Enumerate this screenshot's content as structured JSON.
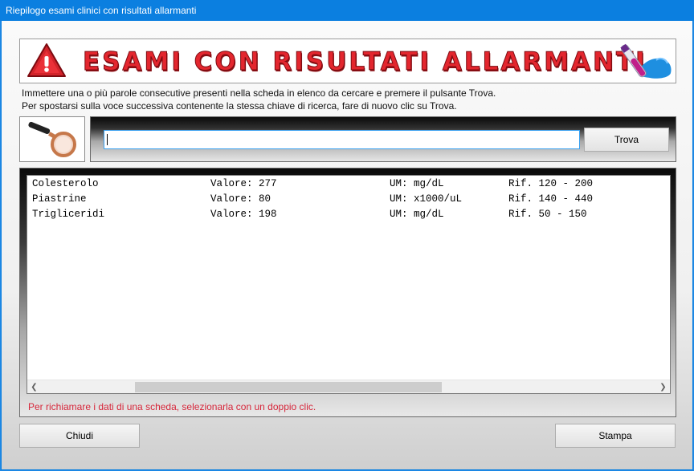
{
  "window": {
    "title": "Riepilogo esami clinici con risultati allarmanti"
  },
  "banner": {
    "title": "ESAMI CON RISULTATI ALLARMANTI",
    "left_icon": "warning-icon",
    "right_icon": "test-tube-icon"
  },
  "instructions": {
    "line1": "Immettere una o più parole consecutive presenti nella scheda in elenco da cercare e premere il pulsante Trova.",
    "line2": "Per spostarsi sulla voce successiva contenente la stessa chiave di ricerca, fare di nuovo clic su Trova."
  },
  "search": {
    "icon": "magnifier-icon",
    "value": "",
    "button_label": "Trova"
  },
  "results": [
    {
      "name": "Colesterolo",
      "value": "Valore: 277",
      "unit": "UM: mg/dL",
      "ref": "Rif. 120 - 200"
    },
    {
      "name": "Piastrine",
      "value": "Valore: 80",
      "unit": "UM: x1000/uL",
      "ref": "Rif. 140 - 440"
    },
    {
      "name": "Trigliceridi",
      "value": "Valore: 198",
      "unit": "UM: mg/dL",
      "ref": "Rif. 50 - 150"
    }
  ],
  "hint": "Per richiamare i dati di una scheda, selezionarla con un doppio clic.",
  "colors": {
    "titlebar": "#0b7fe0",
    "banner_text": "#e3262e",
    "hint_text": "#d6263a"
  },
  "buttons": {
    "close_label": "Chiudi",
    "print_label": "Stampa"
  }
}
